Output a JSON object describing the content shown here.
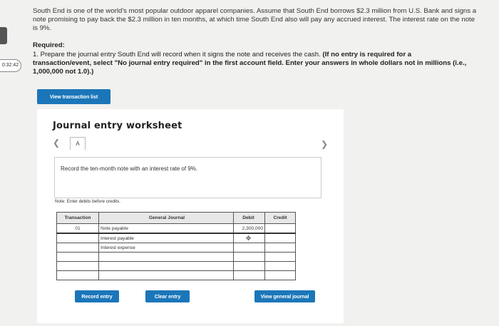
{
  "timer": "0:32:42",
  "question": {
    "intro": "South End is one of the world's most popular outdoor apparel companies. Assume that South End borrows $2.3 million from U.S. Bank and signs a note promising to pay back the $2.3 million in ten months, at which time South End also will pay any accrued interest. The interest rate on the note is 9%.",
    "required_title": "Required:",
    "required_text": "1. Prepare the journal entry South End will record when it signs the note and receives the cash. ",
    "required_bold": "(If no entry is required for a transaction/event, select \"No journal entry required\" in the first account field. Enter your answers in whole dollars not in millions (i.e., 1,000,000 not 1.0).)"
  },
  "buttons": {
    "view_transaction_list": "View transaction list",
    "record_entry": "Record entry",
    "clear_entry": "Clear entry",
    "view_general_journal": "View general journal"
  },
  "worksheet": {
    "title": "Journal entry worksheet",
    "tab_label": "A",
    "description": "Record the ten-month note with an interest rate of 9%.",
    "note": "Note: Enter debits before credits."
  },
  "table": {
    "headers": {
      "transaction": "Transaction",
      "general_journal": "General Journal",
      "debit": "Debit",
      "credit": "Credit"
    },
    "rows": [
      {
        "transaction": "01",
        "account": "Note payable",
        "debit": "2,300,000",
        "credit": ""
      },
      {
        "transaction": "",
        "account": "Interest payable",
        "debit": "",
        "credit": ""
      },
      {
        "transaction": "",
        "account": "Interest expense",
        "debit": "",
        "credit": ""
      },
      {
        "transaction": "",
        "account": "",
        "debit": "",
        "credit": ""
      },
      {
        "transaction": "",
        "account": "",
        "debit": "",
        "credit": ""
      },
      {
        "transaction": "",
        "account": "",
        "debit": "",
        "credit": ""
      }
    ]
  },
  "icons": {
    "prev": "chevron-left-icon",
    "next": "chevron-right-icon",
    "cursor": "move-cursor-icon"
  }
}
